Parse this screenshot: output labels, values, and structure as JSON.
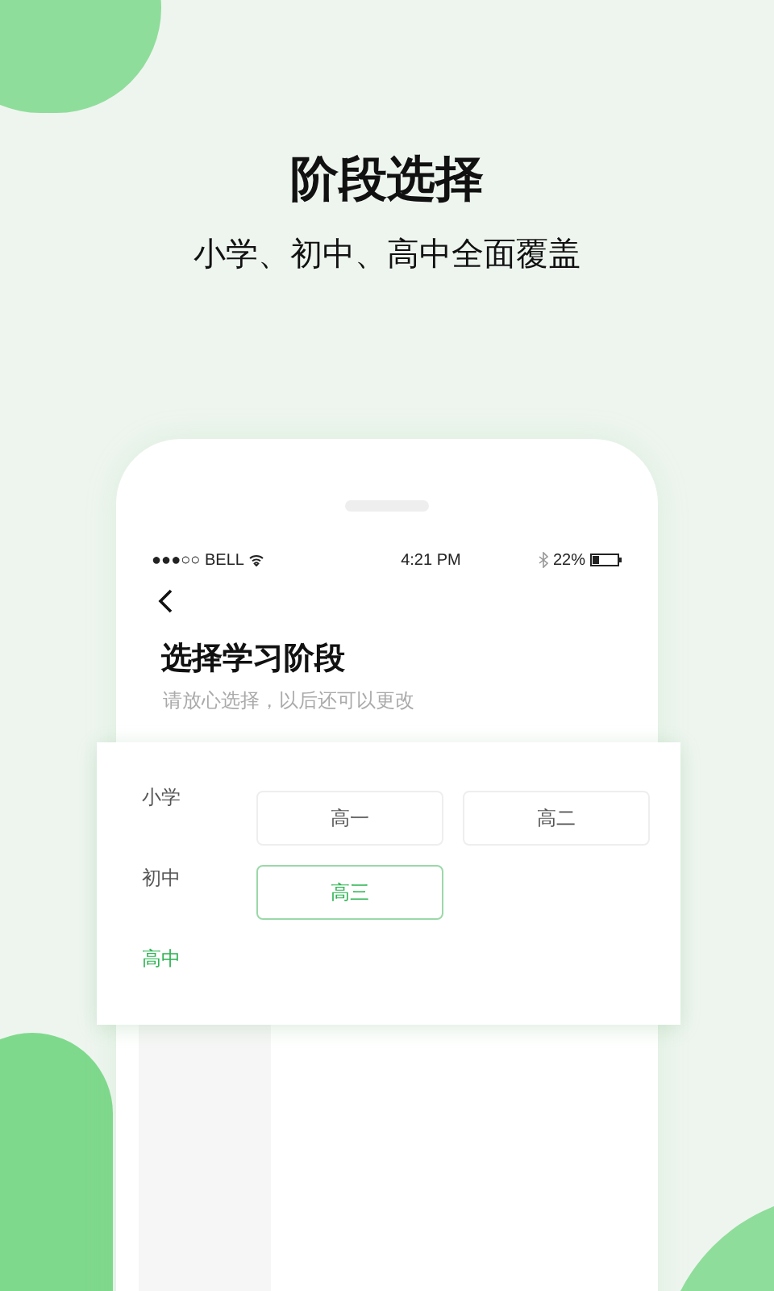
{
  "headline": "阶段选择",
  "subheadline": "小学、初中、高中全面覆盖",
  "status_bar": {
    "carrier": "●●●○○ BELL",
    "time": "4:21 PM",
    "battery": "22%"
  },
  "page": {
    "title": "选择学习阶段",
    "hint": "请放心选择，以后还可以更改"
  },
  "stages": [
    {
      "label": "小学",
      "selected": false
    },
    {
      "label": "初中",
      "selected": false
    },
    {
      "label": "高中",
      "selected": true
    }
  ],
  "grades": [
    {
      "label": "高一",
      "selected": false
    },
    {
      "label": "高二",
      "selected": false
    },
    {
      "label": "高三",
      "selected": true
    }
  ]
}
